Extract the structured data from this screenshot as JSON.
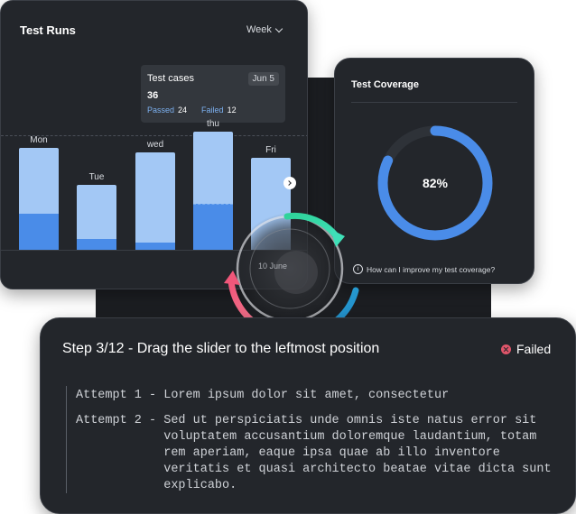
{
  "runs": {
    "title": "Test Runs",
    "range": "Week",
    "tooltip": {
      "title": "Test cases",
      "date": "Jun 5",
      "total": "36",
      "passed_label": "Passed",
      "passed": "24",
      "failed_label": "Failed",
      "failed": "12"
    },
    "days": [
      {
        "label": "Mon",
        "total_fraction": 0.75,
        "passed_fraction": 0.35
      },
      {
        "label": "Tue",
        "total_fraction": 0.48,
        "passed_fraction": 0.16
      },
      {
        "label": "wed",
        "total_fraction": 0.72,
        "passed_fraction": 0.07
      },
      {
        "label": "thu",
        "total_fraction": 0.87,
        "passed_fraction": 0.38
      },
      {
        "label": "Fri",
        "total_fraction": 0.68,
        "passed_fraction": 0.0
      }
    ]
  },
  "coverage": {
    "title": "Test Coverage",
    "percent": "82%",
    "value": 0.82,
    "help": "How can I improve my test coverage?",
    "ring_color": "#4a8ce8"
  },
  "overlay": {
    "date_label": "10 June"
  },
  "step": {
    "title": "Step 3/12 - Drag the slider to the leftmost position",
    "status": "Failed",
    "attempts": [
      {
        "label": "Attempt 1 - ",
        "text": "Lorem ipsum dolor sit amet, consectetur"
      },
      {
        "label": "Attempt 2 - ",
        "text": "Sed ut perspiciatis unde omnis iste natus error sit voluptatem accusantium doloremque laudantium, totam rem aperiam, eaque ipsa quae ab illo inventore veritatis et quasi architecto beatae vitae dicta sunt explicabo."
      }
    ]
  },
  "colors": {
    "bar_light": "#a3c8f5",
    "bar_dark": "#4a8ce8",
    "fail": "#e0556a"
  }
}
